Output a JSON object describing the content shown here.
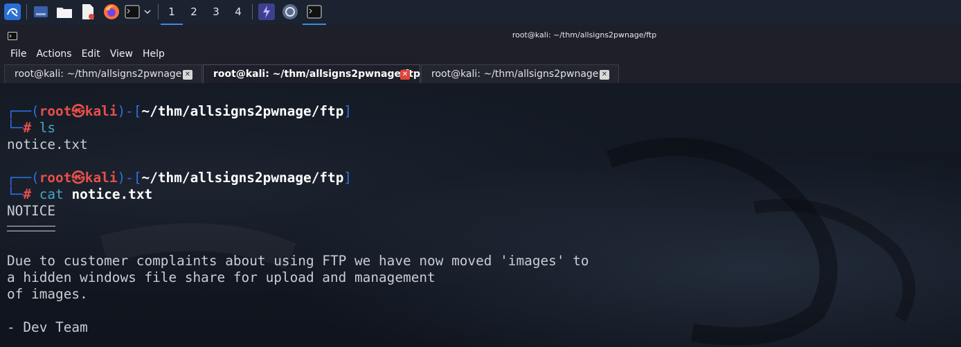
{
  "panel": {
    "workspaces": [
      "1",
      "2",
      "3",
      "4"
    ],
    "icons": [
      "kali-menu-icon",
      "show-desktop-icon",
      "file-manager-icon",
      "text-editor-icon",
      "firefox-icon",
      "terminal-launcher-icon",
      "chevron-down-icon",
      "bolt-icon",
      "browser-circle-icon",
      "terminal-task-icon"
    ]
  },
  "window": {
    "title": "root@kali: ~/thm/allsigns2pwnage/ftp",
    "menu": [
      "File",
      "Actions",
      "Edit",
      "View",
      "Help"
    ],
    "tabs": [
      {
        "label": "root@kali: ~/thm/allsigns2pwnage",
        "active": false
      },
      {
        "label": "root@kali: ~/thm/allsigns2pwnage/ftp",
        "active": true
      },
      {
        "label": "root@kali: ~/thm/allsigns2pwnage",
        "active": false
      }
    ],
    "tab_close": "✕"
  },
  "terminal": {
    "prompt_user": "root",
    "prompt_host": "kali",
    "prompt_sep": "㉿",
    "prompt_path": "~/thm/allsigns2pwnage/ftp",
    "prompt_char": "#",
    "cmd1": "ls",
    "out1": "notice.txt",
    "cmd2_verb": "cat",
    "cmd2_arg": "notice.txt",
    "notice_title": "NOTICE",
    "notice_lines": [
      "Due to customer complaints about using FTP we have now moved 'images' to",
      "a hidden windows file share for upload and management",
      "of images."
    ],
    "signature": "- Dev Team"
  },
  "colors": {
    "prompt_blue": "#2f6fe0",
    "prompt_red": "#e8504a",
    "accent": "#3c8ce7"
  }
}
